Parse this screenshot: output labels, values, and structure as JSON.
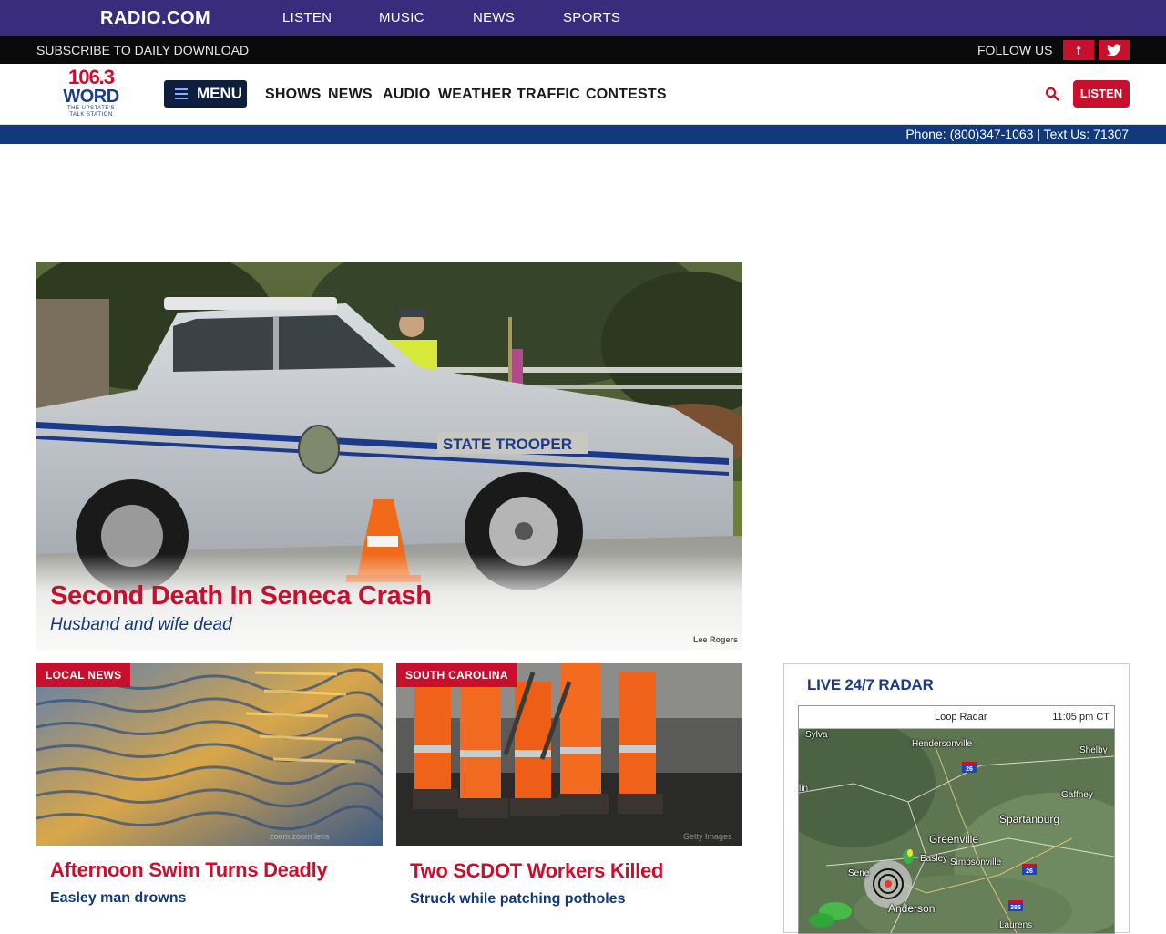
{
  "topbar": {
    "logo": "RADIO.COM",
    "nav": [
      "LISTEN",
      "MUSIC",
      "NEWS",
      "SPORTS"
    ]
  },
  "subbar": {
    "subscribe": "SUBSCRIBE TO DAILY DOWNLOAD",
    "follow": "FOLLOW US",
    "facebook_glyph": "f",
    "twitter_glyph": "t"
  },
  "header": {
    "station": {
      "freq": "106.3",
      "name": "WORD",
      "tagline_1": "THE UPSTATE'S",
      "tagline_2": "TALK STATION"
    },
    "menu_label": "MENU",
    "nav": [
      "SHOWS",
      "NEWS",
      "AUDIO",
      "WEATHER",
      "TRAFFIC",
      "CONTESTS"
    ],
    "listen_label": "LISTEN"
  },
  "phonebar": {
    "text": "Phone: (800)347-1063 | Text Us: 71307"
  },
  "hero": {
    "title": "Second Death In Seneca Crash",
    "subtitle": "Husband and wife dead",
    "credit": "Lee Rogers",
    "car_text": "STATE TROOPER"
  },
  "cards": [
    {
      "badge": "LOCAL NEWS",
      "title": "Afternoon Swim Turns Deadly",
      "subtitle": "Easley man drowns",
      "credit": "zoom zoom lens"
    },
    {
      "badge": "SOUTH CAROLINA",
      "title": "Two SCDOT Workers Killed",
      "subtitle": "Struck while patching potholes",
      "credit": "Getty Images"
    }
  ],
  "radar": {
    "title": "LIVE 24/7 RADAR",
    "loop_label": "Loop Radar",
    "time": "11:05 pm CT",
    "cities": [
      "Sylva",
      "Hendersonville",
      "Shelby",
      "lin",
      "Gaffney",
      "Spartanburg",
      "Greenville",
      "Easley",
      "Simpsonville",
      "Sene",
      "Anderson",
      "Laurens"
    ],
    "highways": [
      "26",
      "26",
      "385"
    ]
  },
  "colors": {
    "brand_purple": "#3a2c7c",
    "accent_red": "#c8102e",
    "navy": "#123a7a"
  }
}
